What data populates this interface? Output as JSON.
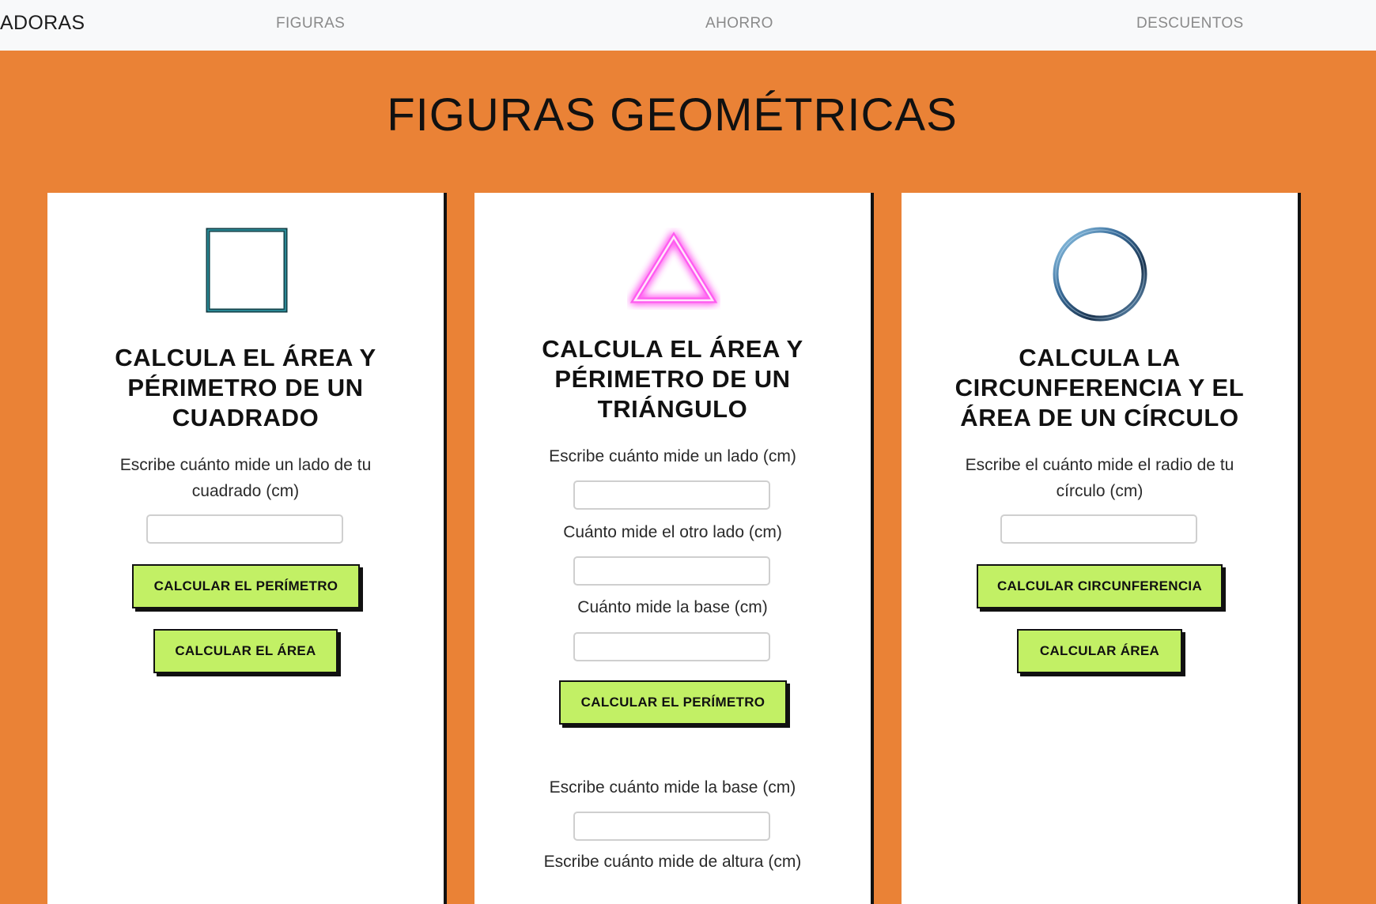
{
  "navbar": {
    "brand": "ADORAS",
    "links": [
      "FIGURAS",
      "AHORRO",
      "DESCUENTOS"
    ]
  },
  "page": {
    "title": "FIGURAS GEOMÉTRICAS"
  },
  "cards": [
    {
      "shape_icon": "square-icon",
      "heading": "CALCULA EL ÁREA Y PÉRIMETRO DE UN CUADRADO",
      "labels": [
        "Escribe cuánto mide un lado de tu cuadrado (cm)"
      ],
      "inputs": [
        {
          "value": "",
          "placeholder": ""
        }
      ],
      "buttons": [
        "CALCULAR EL PERÍMETRO",
        "CALCULAR EL ÁREA"
      ]
    },
    {
      "shape_icon": "triangle-icon",
      "heading": "CALCULA EL ÁREA Y PÉRIMETRO DE UN TRIÁNGULO",
      "labels": [
        "Escribe cuánto mide un lado (cm)",
        "Cuánto mide el otro lado (cm)",
        "Cuánto mide la base (cm)",
        "Escribe cuánto mide la base (cm)",
        "Escribe cuánto mide de altura (cm)"
      ],
      "inputs": [
        {
          "value": "",
          "placeholder": ""
        },
        {
          "value": "",
          "placeholder": ""
        },
        {
          "value": "",
          "placeholder": ""
        },
        {
          "value": "",
          "placeholder": ""
        }
      ],
      "buttons": [
        "CALCULAR EL PERÍMETRO"
      ]
    },
    {
      "shape_icon": "circle-icon",
      "heading": "CALCULA LA CIRCUNFERENCIA Y EL ÁREA DE UN CÍRCULO",
      "labels": [
        "Escribe el cuánto mide el radio de tu círculo (cm)"
      ],
      "inputs": [
        {
          "value": "",
          "placeholder": ""
        }
      ],
      "buttons": [
        "CALCULAR CIRCUNFERENCIA",
        "CALCULAR ÁREA"
      ]
    }
  ],
  "colors": {
    "page_background": "#ea8236",
    "navbar_background": "#f8f9fa",
    "button_background": "#c2f065",
    "triangle_glow": "#ff5cf0",
    "square_glow": "#3fd8e8",
    "circle_ring": "#3c6f9c"
  }
}
